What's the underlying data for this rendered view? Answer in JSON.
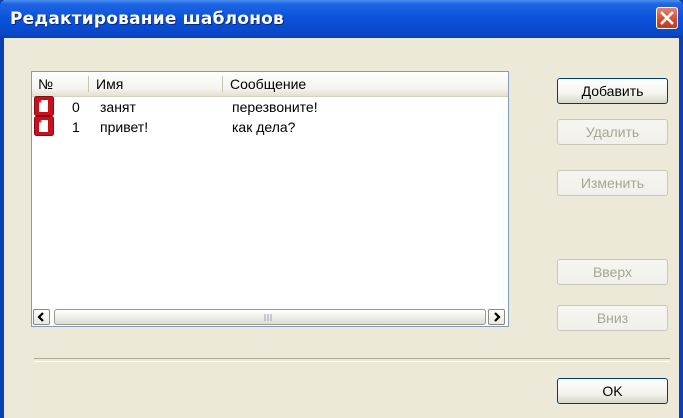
{
  "window": {
    "title": "Редактирование шаблонов"
  },
  "list": {
    "columns": [
      "№",
      "Имя",
      "Сообщение"
    ],
    "rows": [
      {
        "num": "0",
        "name": "занят",
        "message": "перезвоните!"
      },
      {
        "num": "1",
        "name": "привет!",
        "message": "как дела?"
      }
    ],
    "scroll_grip": "III"
  },
  "buttons": {
    "add": "Добавить",
    "delete": "Удалить",
    "edit": "Изменить",
    "up": "Вверх",
    "down": "Вниз",
    "ok": "OK"
  },
  "colors": {
    "title_bar": "#0a4bd0",
    "close_button": "#d54a2c",
    "doc_icon": "#c8101e"
  }
}
